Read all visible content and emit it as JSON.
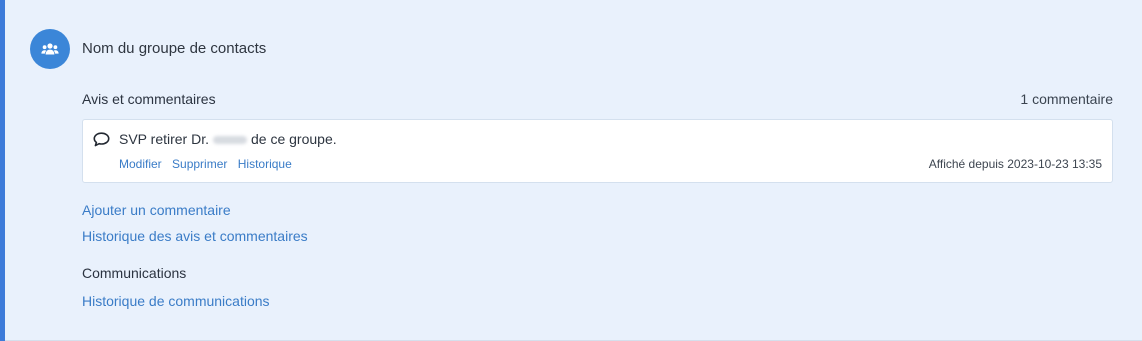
{
  "group": {
    "title": "Nom du groupe de contacts",
    "icon": "people-icon"
  },
  "comments_section": {
    "heading": "Avis et commentaires",
    "count_label": "1 commentaire",
    "items": [
      {
        "text_before": "SVP retirer Dr.",
        "text_after": "de ce groupe.",
        "actions": {
          "edit": "Modifier",
          "delete": "Supprimer",
          "history": "Historique"
        },
        "posted": "Affiché depuis 2023-10-23 13:35"
      }
    ],
    "add_link": "Ajouter un commentaire",
    "history_link": "Historique des avis et commentaires"
  },
  "communications": {
    "heading": "Communications",
    "history_link": "Historique de communications"
  },
  "colors": {
    "accent": "#3d7bd9",
    "link": "#3a7cc7",
    "panel_bg": "#e9f1fc"
  }
}
